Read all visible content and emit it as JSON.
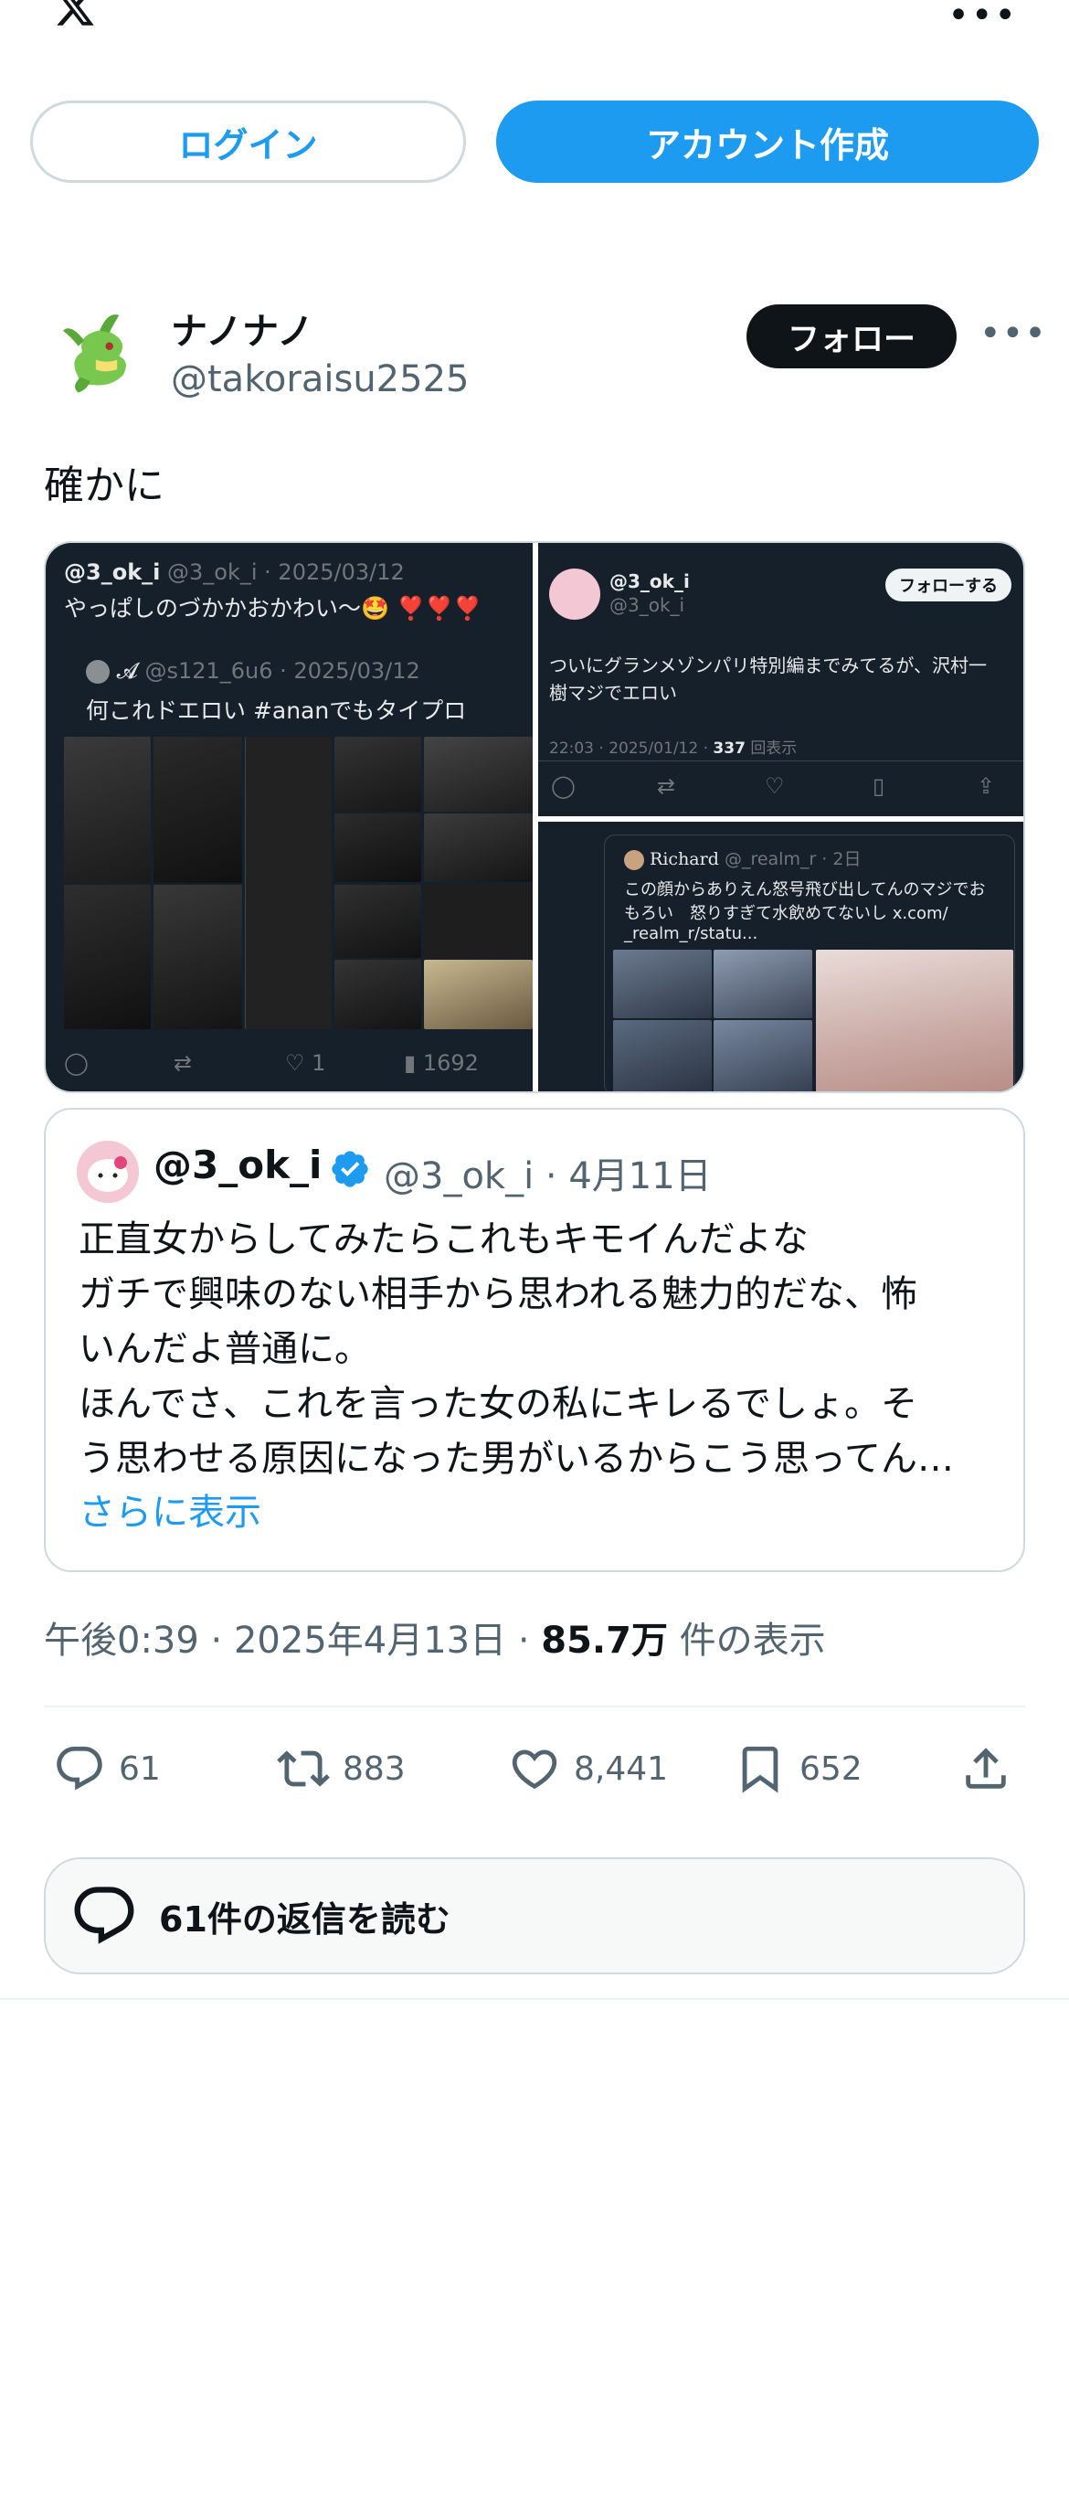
{
  "header": {
    "logo_icon": "x-logo-icon",
    "more_icon": "more-horizontal-icon",
    "login_label": "ログイン",
    "signup_label": "アカウント作成",
    "accent_color": "#1d9bf0"
  },
  "tweet": {
    "author_name": "ナノナノ",
    "author_handle": "@takoraisu2525",
    "follow_label": "フォロー",
    "text": "確かに",
    "media": {
      "left": {
        "name": "@3_ok_i",
        "meta": "@3_ok_i · 2025/03/12",
        "text": "やっぱしのづかかおかわい〜🤩 ❣️❣️❣️",
        "inner_meta": "@s121_6u6 · 2025/03/12",
        "inner_text": "何これドエロい #ananでもタイプロ",
        "likes": "1",
        "views": "1692"
      },
      "right_top": {
        "name": "@3_ok_i",
        "handle": "@3_ok_i",
        "follow_label": "フォローする",
        "text_line1": "ついにグランメゾンパリ特別編までみてるが、沢村一",
        "text_line2": "樹マジでエロい",
        "meta_time": "22:03 · 2025/01/12 ·",
        "meta_views": "337",
        "meta_suffix": "回表示"
      },
      "right_bottom": {
        "name": "Richard",
        "meta": "@_realm_r · 2日",
        "text_line1": "この顔からありえん怒号飛び出してんのマジでお",
        "text_line2": "もろい　怒りすぎて水飲めてないし x.com/",
        "text_line3": "_realm_r/statu..."
      }
    },
    "quote": {
      "name": "@3_ok_i",
      "meta": "@3_ok_i · 4月11日",
      "lines": [
        "正直女からしてみたらこれもキモイんだよな",
        "ガチで興味のない相手から思われる魅力的だな、怖",
        "いんだよ普通に。",
        "ほんでさ、これを言った女の私にキレるでしょ。そ",
        "う思わせる原因になった男がいるからこう思ってん…"
      ],
      "show_more": "さらに表示"
    },
    "timestamp": "午後0:39 · 2025年4月13日 · ",
    "views_count": "85.7万",
    "views_label": " 件の表示",
    "stats": {
      "replies": "61",
      "retweets": "883",
      "likes": "8,441",
      "bookmarks": "652"
    },
    "read_replies_label": "61件の返信を読む"
  }
}
